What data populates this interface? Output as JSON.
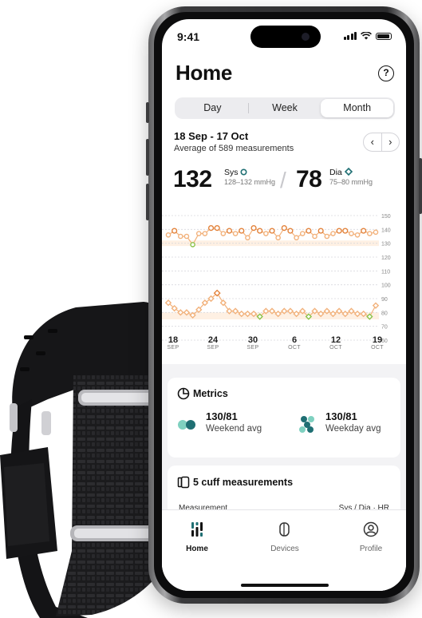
{
  "status": {
    "time": "9:41"
  },
  "header": {
    "title": "Home",
    "help_icon": "?"
  },
  "segments": [
    {
      "label": "Day",
      "active": false
    },
    {
      "label": "Week",
      "active": false
    },
    {
      "label": "Month",
      "active": true
    }
  ],
  "summary": {
    "range": "18 Sep - 17 Oct",
    "subtitle": "Average of 589 measurements",
    "prev": "‹",
    "next": "›"
  },
  "readings": {
    "sys": {
      "value": "132",
      "label": "Sys",
      "range": "128–132 mmHg"
    },
    "dia": {
      "value": "78",
      "label": "Dia",
      "range": "75–80 mmHg"
    },
    "separator": "/"
  },
  "chart_data": {
    "type": "line",
    "title": "",
    "y_ticks": [
      150,
      140,
      130,
      120,
      110,
      100,
      90,
      80,
      70,
      60
    ],
    "ylim": [
      60,
      150
    ],
    "x_ticks": [
      {
        "day": "18",
        "month": "SEP"
      },
      {
        "day": "24",
        "month": "SEP"
      },
      {
        "day": "30",
        "month": "SEP"
      },
      {
        "day": "6",
        "month": "OCT"
      },
      {
        "day": "12",
        "month": "OCT"
      },
      {
        "day": "19",
        "month": "OCT"
      }
    ],
    "series": [
      {
        "values": [
          136,
          139,
          135,
          135,
          129,
          137,
          137,
          141,
          141,
          137,
          139,
          137,
          139,
          134,
          141,
          139,
          137,
          139,
          134,
          141,
          139,
          134,
          137,
          139,
          135,
          139,
          135,
          137,
          139,
          139,
          137,
          136,
          139,
          137,
          138
        ],
        "color": "#f2b27c",
        "highlight_color": "#e3823a",
        "low_color": "#8bc34a",
        "band": [
          128,
          132
        ]
      },
      {
        "values": [
          87,
          83,
          80,
          80,
          78,
          82,
          87,
          90,
          94,
          87,
          81,
          81,
          79,
          79,
          79,
          77,
          81,
          81,
          79,
          81,
          81,
          79,
          81,
          77,
          81,
          79,
          81,
          79,
          81,
          79,
          81,
          79,
          79,
          77,
          85
        ],
        "color": "#f2b27c",
        "highlight_color": "#e3823a",
        "low_color": "#8bc34a",
        "band": [
          75,
          80
        ]
      }
    ]
  },
  "metrics": {
    "title": "Metrics",
    "weekend": {
      "value": "130/81",
      "label": "Weekend avg"
    },
    "weekday": {
      "value": "130/81",
      "label": "Weekday avg"
    }
  },
  "cuff": {
    "title": "5 cuff measurements",
    "row_left": "Measurement",
    "row_right": "Sys / Dia · HR"
  },
  "tabs": [
    {
      "label": "Home",
      "active": true
    },
    {
      "label": "Devices",
      "active": false
    },
    {
      "label": "Profile",
      "active": false
    }
  ],
  "colors": {
    "orange": "#f2b27c",
    "orange_dark": "#e3823a",
    "green": "#8bc34a",
    "teal": "#1f6f73",
    "mint": "#7fd1c0",
    "band": "#fde4cc"
  }
}
